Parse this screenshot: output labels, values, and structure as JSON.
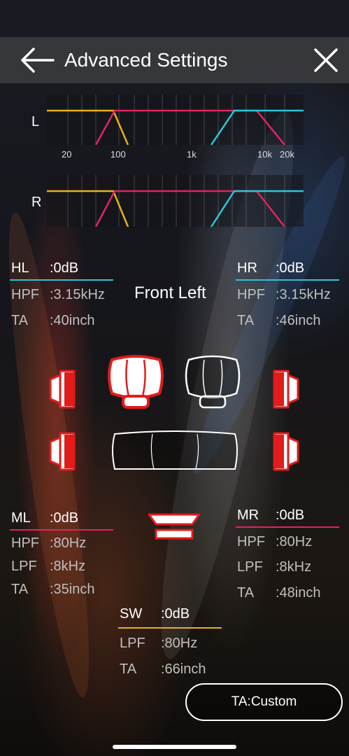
{
  "header": {
    "title": "Advanced Settings",
    "back_icon": "back-arrow-icon",
    "close_icon": "close-icon"
  },
  "eq": {
    "left_label": "L",
    "right_label": "R",
    "freq_labels": [
      "20",
      "100",
      "1k",
      "10k",
      "20k"
    ]
  },
  "channels": {
    "hl": {
      "name": "HL",
      "gain": ":0dB",
      "hpf_label": "HPF",
      "hpf": ":3.15kHz",
      "ta_label": "TA",
      "ta": ":40inch"
    },
    "hr": {
      "name": "HR",
      "gain": ":0dB",
      "hpf_label": "HPF",
      "hpf": ":3.15kHz",
      "ta_label": "TA",
      "ta": ":46inch"
    },
    "ml": {
      "name": "ML",
      "gain": ":0dB",
      "hpf_label": "HPF",
      "hpf": ":80Hz",
      "lpf_label": "LPF",
      "lpf": ":8kHz",
      "ta_label": "TA",
      "ta": ":35inch"
    },
    "mr": {
      "name": "MR",
      "gain": ":0dB",
      "hpf_label": "HPF",
      "hpf": ":80Hz",
      "lpf_label": "LPF",
      "lpf": ":8kHz",
      "ta_label": "TA",
      "ta": ":48inch"
    },
    "sw": {
      "name": "SW",
      "gain": ":0dB",
      "lpf_label": "LPF",
      "lpf": ":80Hz",
      "ta_label": "TA",
      "ta": ":66inch"
    }
  },
  "selected_position": "Front Left",
  "ta_button_label": "TA:Custom",
  "colors": {
    "tweeter": "#2ec4d6",
    "mid": "#e0245e",
    "sub": "#e8b020",
    "active_speaker": "#e21b1b"
  }
}
